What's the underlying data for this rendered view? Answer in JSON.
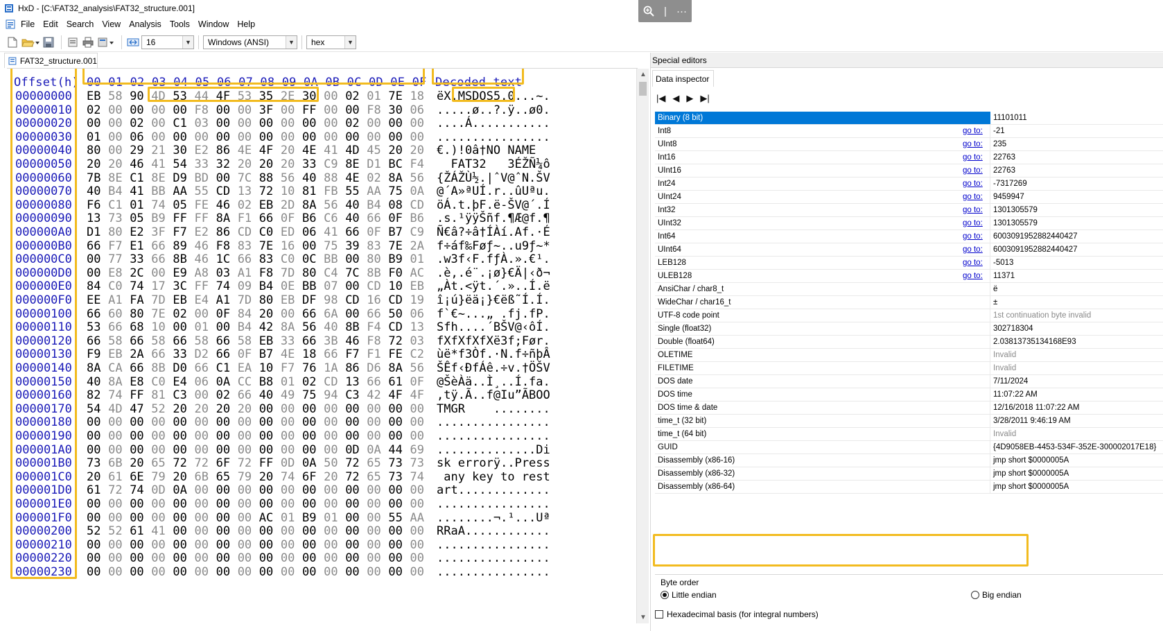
{
  "window": {
    "title": "HxD - [C:\\FAT32_analysis\\FAT32_structure.001]"
  },
  "overlay": {
    "zoom_icon": "zoom-in-icon",
    "more_icon": "more-icon",
    "sep": "|",
    "more": "···"
  },
  "menu": [
    "File",
    "Edit",
    "Search",
    "View",
    "Analysis",
    "Tools",
    "Window",
    "Help"
  ],
  "toolbar": {
    "bytes_per_row": "16",
    "charset": "Windows (ANSI)",
    "display_mode": "hex"
  },
  "document_tab": "FAT32_structure.001",
  "hex": {
    "offset_header": "Offset(h)",
    "column_header": "00 01 02 03 04 05 06 07 08 09 0A 0B 0C 0D 0E 0F",
    "decoded_header": "Decoded text",
    "rows": [
      {
        "off": "00000000",
        "bytes": "EB 58 90 4D 53 44 4F 53 35 2E 30 00 02 01 7E 18",
        "text": "ëX.MSDOS5.0...~."
      },
      {
        "off": "00000010",
        "bytes": "02 00 00 00 00 F8 00 00 3F 00 FF 00 00 F8 30 06",
        "text": ".....ø..?.ÿ..ø0."
      },
      {
        "off": "00000020",
        "bytes": "00 00 02 00 C1 03 00 00 00 00 00 00 02 00 00 00",
        "text": "....Á..........."
      },
      {
        "off": "00000030",
        "bytes": "01 00 06 00 00 00 00 00 00 00 00 00 00 00 00 00",
        "text": "................"
      },
      {
        "off": "00000040",
        "bytes": "80 00 29 21 30 E2 86 4E 4F 20 4E 41 4D 45 20 20",
        "text": "€.)!0â†NO NAME  "
      },
      {
        "off": "00000050",
        "bytes": "20 20 46 41 54 33 32 20 20 20 33 C9 8E D1 BC F4",
        "text": "  FAT32   3ÉŽÑ¼ô"
      },
      {
        "off": "00000060",
        "bytes": "7B 8E C1 8E D9 BD 00 7C 88 56 40 88 4E 02 8A 56",
        "text": "{ŽÁŽÙ½.|ˆV@ˆN.ŠV"
      },
      {
        "off": "00000070",
        "bytes": "40 B4 41 BB AA 55 CD 13 72 10 81 FB 55 AA 75 0A",
        "text": "@´A»ªUÍ.r..ûUªu."
      },
      {
        "off": "00000080",
        "bytes": "F6 C1 01 74 05 FE 46 02 EB 2D 8A 56 40 B4 08 CD",
        "text": "öÁ.t.þF.ë-ŠV@´.Í"
      },
      {
        "off": "00000090",
        "bytes": "13 73 05 B9 FF FF 8A F1 66 0F B6 C6 40 66 0F B6",
        "text": ".s.¹ÿÿŠñf.¶Æ@f.¶"
      },
      {
        "off": "000000A0",
        "bytes": "D1 80 E2 3F F7 E2 86 CD C0 ED 06 41 66 0F B7 C9",
        "text": "Ñ€â?÷â†ÍÀí.Af.·É"
      },
      {
        "off": "000000B0",
        "bytes": "66 F7 E1 66 89 46 F8 83 7E 16 00 75 39 83 7E 2A",
        "text": "f÷áf‰Føƒ~..u9ƒ~*"
      },
      {
        "off": "000000C0",
        "bytes": "00 77 33 66 8B 46 1C 66 83 C0 0C BB 00 80 B9 01",
        "text": ".w3f‹F.fƒÀ.».€¹."
      },
      {
        "off": "000000D0",
        "bytes": "00 E8 2C 00 E9 A8 03 A1 F8 7D 80 C4 7C 8B F0 AC",
        "text": ".è,.é¨.¡ø}€Ä|‹ð¬"
      },
      {
        "off": "000000E0",
        "bytes": "84 C0 74 17 3C FF 74 09 B4 0E BB 07 00 CD 10 EB",
        "text": "„Àt.<ÿt.´.»..Í.ë"
      },
      {
        "off": "000000F0",
        "bytes": "EE A1 FA 7D EB E4 A1 7D 80 EB DF 98 CD 16 CD 19",
        "text": "î¡ú}ëä¡}€ëß˜Í.Í."
      },
      {
        "off": "00000100",
        "bytes": "66 60 80 7E 02 00 0F 84 20 00 66 6A 00 66 50 06",
        "text": "f`€~...„ .fj.fP."
      },
      {
        "off": "00000110",
        "bytes": "53 66 68 10 00 01 00 B4 42 8A 56 40 8B F4 CD 13",
        "text": "Sfh....´BŠV@‹ôÍ."
      },
      {
        "off": "00000120",
        "bytes": "66 58 66 58 66 58 66 58 EB 33 66 3B 46 F8 72 03",
        "text": "fXfXfXfXë3f;Før."
      },
      {
        "off": "00000130",
        "bytes": "F9 EB 2A 66 33 D2 66 0F B7 4E 18 66 F7 F1 FE C2",
        "text": "ùë*f3Òf.·N.f÷ñþÂ"
      },
      {
        "off": "00000140",
        "bytes": "8A CA 66 8B D0 66 C1 EA 10 F7 76 1A 86 D6 8A 56",
        "text": "ŠÊf‹ÐfÁê.÷v.†ÖŠV"
      },
      {
        "off": "00000150",
        "bytes": "40 8A E8 C0 E4 06 0A CC B8 01 02 CD 13 66 61 0F",
        "text": "@ŠèÀä..Ì¸..Í.fa."
      },
      {
        "off": "00000160",
        "bytes": "82 74 FF 81 C3 00 02 66 40 49 75 94 C3 42 4F 4F",
        "text": "‚tÿ.Ã..f@Iu”ÃBOO"
      },
      {
        "off": "00000170",
        "bytes": "54 4D 47 52 20 20 20 20 00 00 00 00 00 00 00 00",
        "text": "TMGR    ........"
      },
      {
        "off": "00000180",
        "bytes": "00 00 00 00 00 00 00 00 00 00 00 00 00 00 00 00",
        "text": "................"
      },
      {
        "off": "00000190",
        "bytes": "00 00 00 00 00 00 00 00 00 00 00 00 00 00 00 00",
        "text": "................"
      },
      {
        "off": "000001A0",
        "bytes": "00 00 00 00 00 00 00 00 00 00 00 00 0D 0A 44 69",
        "text": "..............Di"
      },
      {
        "off": "000001B0",
        "bytes": "73 6B 20 65 72 72 6F 72 FF 0D 0A 50 72 65 73 73",
        "text": "sk errorÿ..Press"
      },
      {
        "off": "000001C0",
        "bytes": "20 61 6E 79 20 6B 65 79 20 74 6F 20 72 65 73 74",
        "text": " any key to rest"
      },
      {
        "off": "000001D0",
        "bytes": "61 72 74 0D 0A 00 00 00 00 00 00 00 00 00 00 00",
        "text": "art............."
      },
      {
        "off": "000001E0",
        "bytes": "00 00 00 00 00 00 00 00 00 00 00 00 00 00 00 00",
        "text": "................"
      },
      {
        "off": "000001F0",
        "bytes": "00 00 00 00 00 00 00 00 AC 01 B9 01 00 00 55 AA",
        "text": "........¬.¹...Uª"
      },
      {
        "off": "00000200",
        "bytes": "52 52 61 41 00 00 00 00 00 00 00 00 00 00 00 00",
        "text": "RRaA............"
      },
      {
        "off": "00000210",
        "bytes": "00 00 00 00 00 00 00 00 00 00 00 00 00 00 00 00",
        "text": "................"
      },
      {
        "off": "00000220",
        "bytes": "00 00 00 00 00 00 00 00 00 00 00 00 00 00 00 00",
        "text": "................"
      },
      {
        "off": "00000230",
        "bytes": "00 00 00 00 00 00 00 00 00 00 00 00 00 00 00 00",
        "text": "................"
      }
    ]
  },
  "special_editors": {
    "title": "Special editors",
    "tab": "Data inspector",
    "nav_icons": [
      "first-icon",
      "prev-icon",
      "next-icon",
      "last-icon"
    ],
    "nav_glyphs": [
      "|◀",
      "◀",
      "▶",
      "▶|"
    ],
    "rows": [
      {
        "name": "Binary (8 bit)",
        "goto": "",
        "value": "11101011",
        "selected": true
      },
      {
        "name": "Int8",
        "goto": "go to:",
        "value": "-21"
      },
      {
        "name": "UInt8",
        "goto": "go to:",
        "value": "235"
      },
      {
        "name": "Int16",
        "goto": "go to:",
        "value": "22763"
      },
      {
        "name": "UInt16",
        "goto": "go to:",
        "value": "22763"
      },
      {
        "name": "Int24",
        "goto": "go to:",
        "value": "-7317269"
      },
      {
        "name": "UInt24",
        "goto": "go to:",
        "value": "9459947"
      },
      {
        "name": "Int32",
        "goto": "go to:",
        "value": "1301305579"
      },
      {
        "name": "UInt32",
        "goto": "go to:",
        "value": "1301305579"
      },
      {
        "name": "Int64",
        "goto": "go to:",
        "value": "6003091952882440427"
      },
      {
        "name": "UInt64",
        "goto": "go to:",
        "value": "6003091952882440427"
      },
      {
        "name": "LEB128",
        "goto": "go to:",
        "value": "-5013"
      },
      {
        "name": "ULEB128",
        "goto": "go to:",
        "value": "11371"
      },
      {
        "name": "AnsiChar / char8_t",
        "goto": "",
        "value": "ë"
      },
      {
        "name": "WideChar / char16_t",
        "goto": "",
        "value": "±"
      },
      {
        "name": "UTF-8 code point",
        "goto": "",
        "value": "1st continuation byte invalid",
        "invalid": true
      },
      {
        "name": "Single (float32)",
        "goto": "",
        "value": "302718304"
      },
      {
        "name": "Double (float64)",
        "goto": "",
        "value": "2.03813735134168E93"
      },
      {
        "name": "OLETIME",
        "goto": "",
        "value": "Invalid",
        "invalid": true
      },
      {
        "name": "FILETIME",
        "goto": "",
        "value": "Invalid",
        "invalid": true
      },
      {
        "name": "DOS date",
        "goto": "",
        "value": "7/11/2024"
      },
      {
        "name": "DOS time",
        "goto": "",
        "value": "11:07:22 AM"
      },
      {
        "name": "DOS time & date",
        "goto": "",
        "value": "12/16/2018 11:07:22 AM"
      },
      {
        "name": "time_t (32 bit)",
        "goto": "",
        "value": "3/28/2011 9:46:19 AM"
      },
      {
        "name": "time_t (64 bit)",
        "goto": "",
        "value": "Invalid",
        "invalid": true
      },
      {
        "name": "GUID",
        "goto": "",
        "value": "{4D9058EB-4453-534F-352E-300002017E18}"
      },
      {
        "name": "Disassembly (x86-16)",
        "goto": "",
        "value": "jmp short $0000005A"
      },
      {
        "name": "Disassembly (x86-32)",
        "goto": "",
        "value": "jmp short $0000005A"
      },
      {
        "name": "Disassembly (x86-64)",
        "goto": "",
        "value": "jmp short $0000005A"
      }
    ],
    "byte_order": {
      "label": "Byte order",
      "little": "Little endian",
      "big": "Big endian",
      "selected": "little"
    },
    "hex_basis": "Hexadecimal basis (for integral numbers)"
  },
  "colors": {
    "highlight": "#f2bb1f",
    "offset_blue": "#1a1ab8",
    "selection": "#0078d7"
  }
}
